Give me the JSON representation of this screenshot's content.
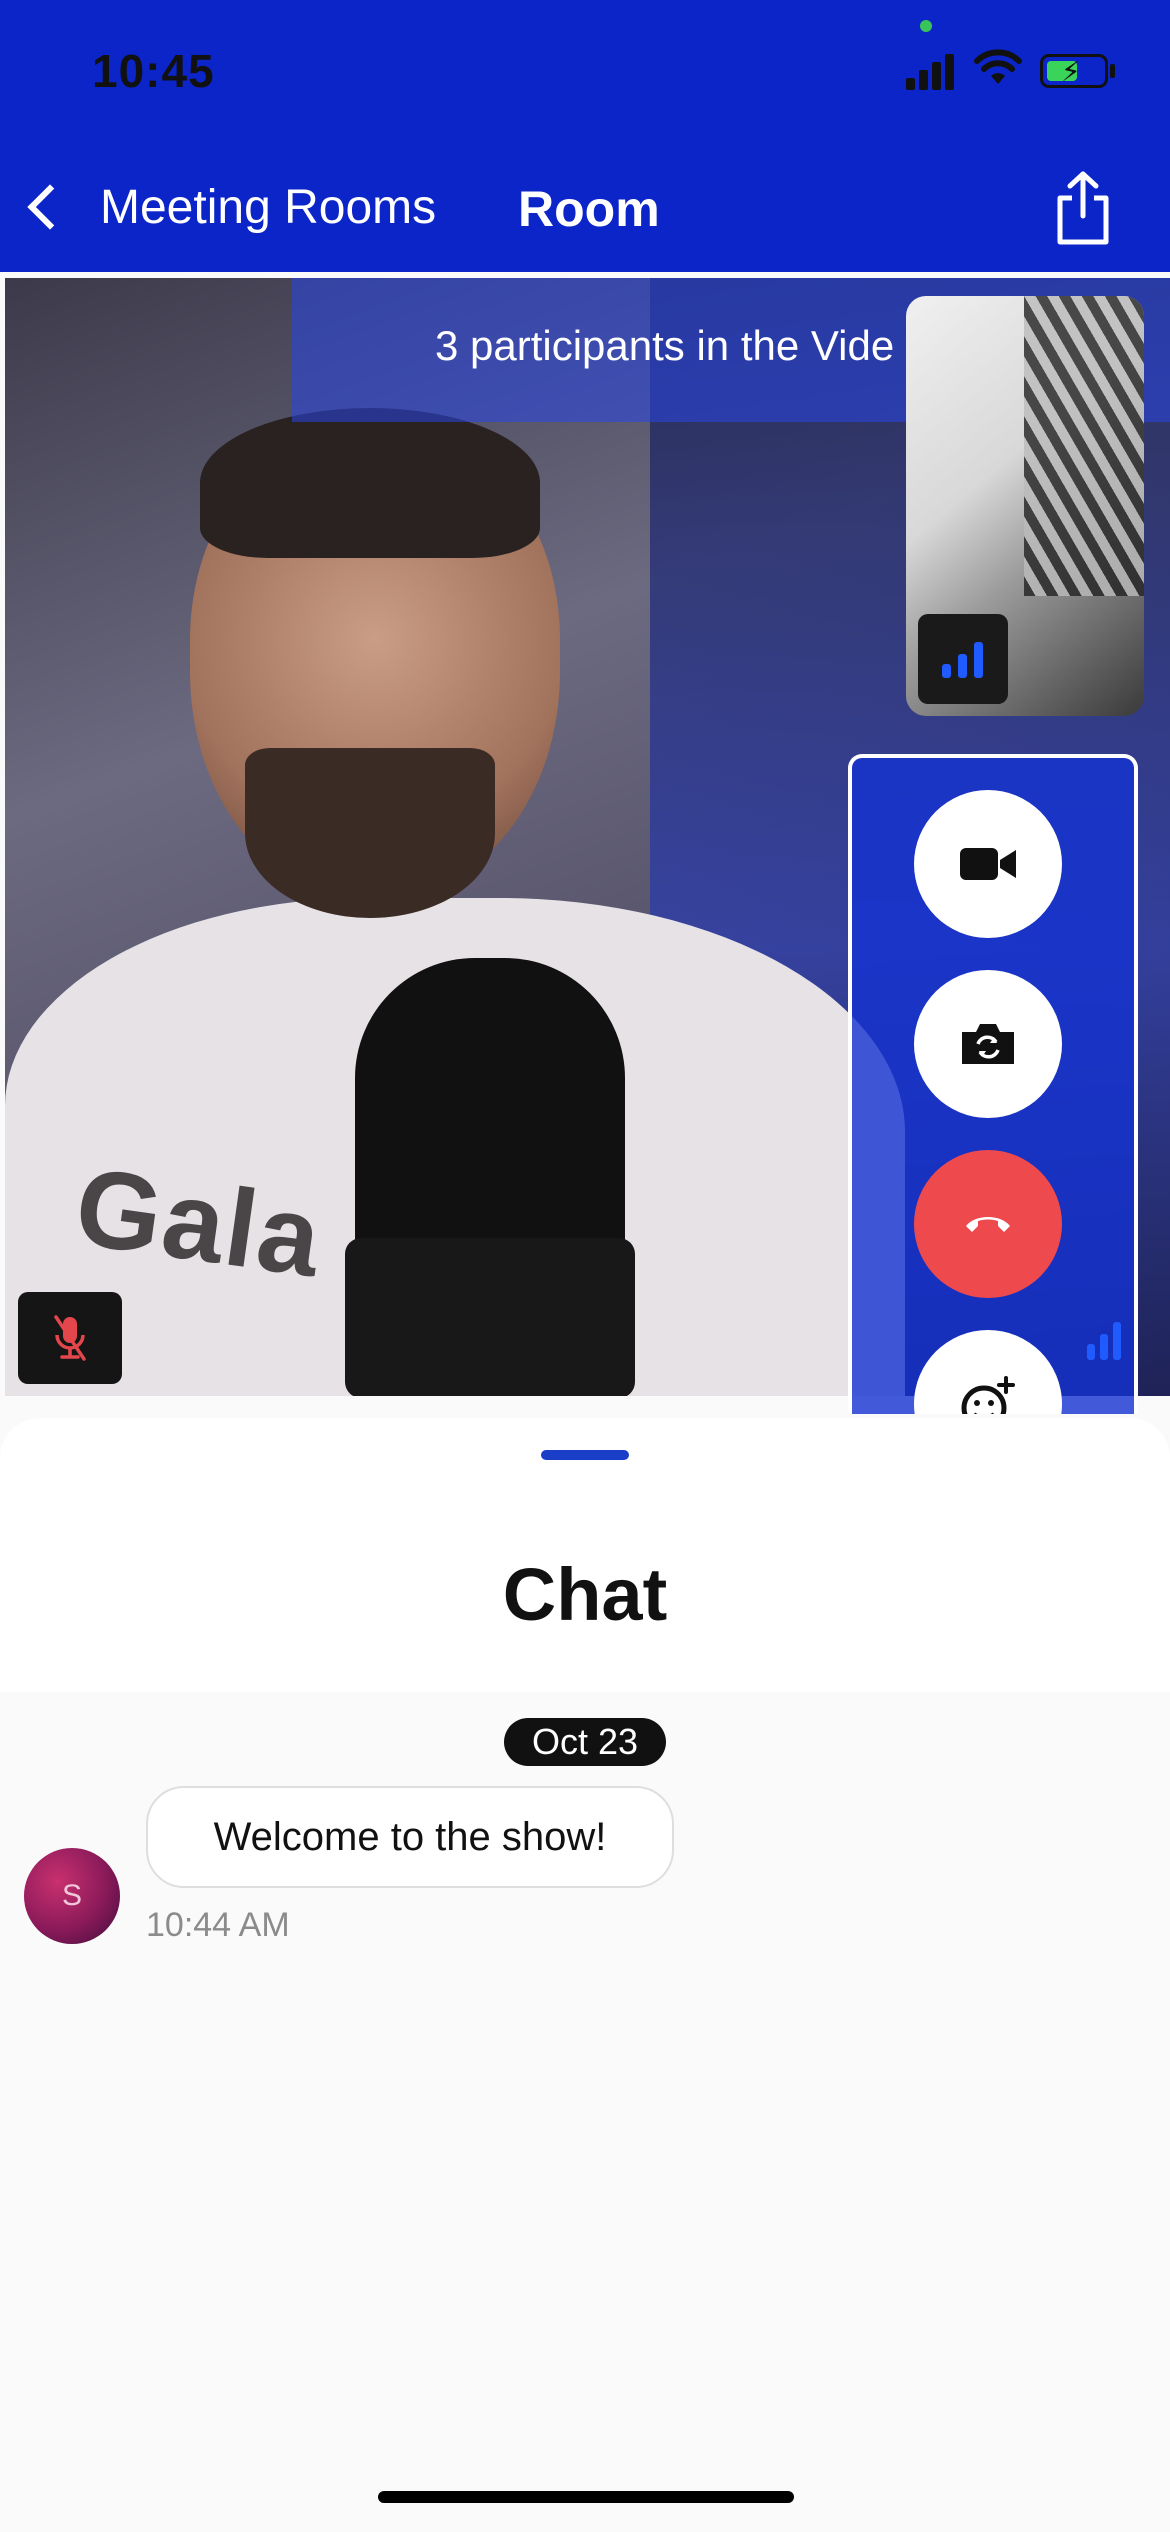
{
  "status_bar": {
    "time": "10:45"
  },
  "nav": {
    "back_label": "Meeting Rooms",
    "title": "Room"
  },
  "video": {
    "participants_text": "3 participants in the Vide",
    "shirt_text": "Gala ic"
  },
  "controls": [
    "camera-toggle",
    "flip-camera",
    "hang-up",
    "add-reaction"
  ],
  "chat": {
    "title": "Chat",
    "date": "Oct 23",
    "messages": [
      {
        "avatar_initial": "S",
        "text": "Welcome to the show!",
        "time": "10:44 AM"
      }
    ]
  },
  "colors": {
    "header": "#0b25c9",
    "hangup": "#ee4a4e",
    "accent": "#1f5bff"
  }
}
